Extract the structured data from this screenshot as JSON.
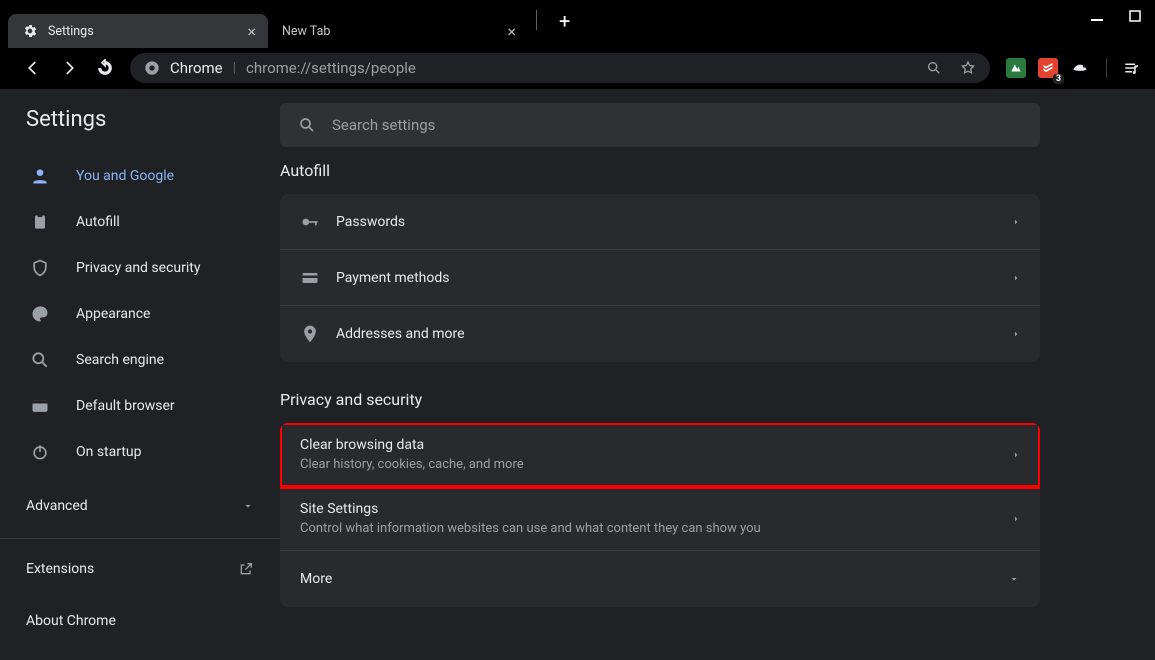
{
  "tabs": [
    {
      "title": "Settings"
    },
    {
      "title": "New Tab"
    }
  ],
  "omnibox": {
    "label": "Chrome",
    "url": "chrome://settings/people"
  },
  "sidebar": {
    "title": "Settings",
    "items": [
      {
        "label": "You and Google"
      },
      {
        "label": "Autofill"
      },
      {
        "label": "Privacy and security"
      },
      {
        "label": "Appearance"
      },
      {
        "label": "Search engine"
      },
      {
        "label": "Default browser"
      },
      {
        "label": "On startup"
      }
    ],
    "advanced": "Advanced",
    "extensions": "Extensions",
    "about": "About Chrome"
  },
  "search": {
    "placeholder": "Search settings"
  },
  "sections": {
    "autofill": {
      "title": "Autofill",
      "rows": [
        {
          "label": "Passwords"
        },
        {
          "label": "Payment methods"
        },
        {
          "label": "Addresses and more"
        }
      ]
    },
    "privacy": {
      "title": "Privacy and security",
      "rows": [
        {
          "label": "Clear browsing data",
          "sub": "Clear history, cookies, cache, and more"
        },
        {
          "label": "Site Settings",
          "sub": "Control what information websites can use and what content they can show you"
        },
        {
          "label": "More"
        }
      ]
    }
  },
  "ext_badge": "3"
}
